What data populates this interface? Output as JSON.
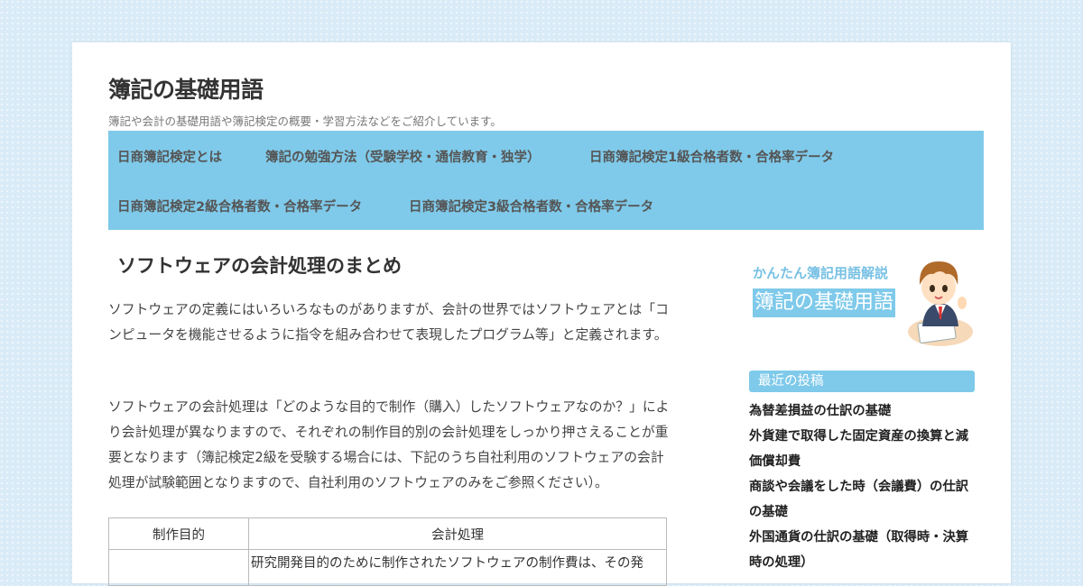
{
  "site": {
    "title": "簿記の基礎用語",
    "tagline": "簿記や会計の基礎用語や簿記検定の概要・学習方法などをご紹介しています。"
  },
  "nav": {
    "items": [
      {
        "label": "日商簿記検定とは"
      },
      {
        "label": "簿記の勉強方法（受験学校・通信教育・独学）"
      },
      {
        "label": "日商簿記検定1級合格者数・合格率データ"
      },
      {
        "label": "日商簿記検定2級合格者数・合格率データ"
      },
      {
        "label": "日商簿記検定3級合格者数・合格率データ"
      }
    ]
  },
  "article": {
    "title": "ソフトウェアの会計処理のまとめ",
    "para1": "ソフトウェアの定義にはいろいろなものがありますが、会計の世界ではソフトウェアとは「コンピュータを機能させるように指令を組み合わせて表現したプログラム等」と定義されます。",
    "para2": "ソフトウェアの会計処理は「どのような目的で制作（購入）したソフトウェアなのか？」により会計処理が異なりますので、それぞれの制作目的別の会計処理をしっかり押さえることが重要となります（簿記検定2級を受験する場合には、下記のうち自社利用のソフトウェアの会計処理が試験範囲となりますので、自社利用のソフトウェアのみをご参照ください）。",
    "table": {
      "headers": [
        "制作目的",
        "会計処理"
      ],
      "row1_col1": "",
      "row1_col2": "研究開発目的のために制作されたソフトウェアの制作費は、その発"
    }
  },
  "sidebar": {
    "banner_sub": "かんたん簿記用語解説",
    "banner_main": "簿記の基礎用語",
    "recent_heading": "最近の投稿",
    "recent_posts": [
      {
        "label": "為替差損益の仕訳の基礎"
      },
      {
        "label": "外貨建で取得した固定資産の換算と減価償却費"
      },
      {
        "label": "商談や会議をした時（会議費）の仕訳の基礎"
      },
      {
        "label": "外国通貨の仕訳の基礎（取得時・決算時の処理）"
      }
    ]
  },
  "colors": {
    "accent": "#7fcaea",
    "background": "#d9ebf7"
  }
}
